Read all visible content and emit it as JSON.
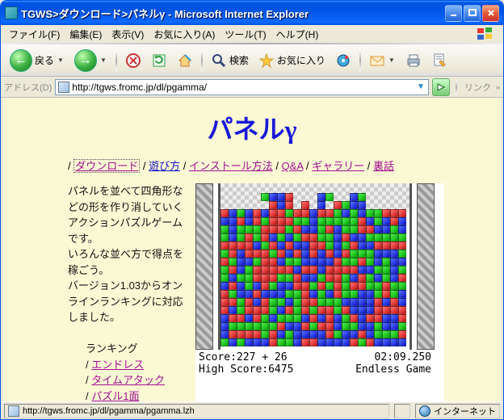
{
  "window": {
    "title": "TGWS>ダウンロード>パネルγ - Microsoft Internet Explorer"
  },
  "menubar": {
    "items": [
      "ファイル(F)",
      "編集(E)",
      "表示(V)",
      "お気に入り(A)",
      "ツール(T)",
      "ヘルプ(H)"
    ]
  },
  "toolbar": {
    "back": "戻る",
    "search": "検索",
    "favorites": "お気に入り"
  },
  "addressbar": {
    "label": "アドレス(D)",
    "url": "http://tgws.fromc.jp/dl/pgamma/",
    "links": "リンク"
  },
  "page": {
    "heading": "パネルγ",
    "nav": {
      "sep": " / ",
      "items": [
        "ダウンロード",
        "遊び方",
        "インストール方法",
        "Q&A",
        "ギャラリー",
        "裏話"
      ]
    },
    "desc": {
      "p1": "パネルを並べて四角形などの形を作り消していくアクションパズルゲームです。",
      "p2": "いろんな並べ方で得点を稼ごう。",
      "p3": "バージョン1.03からオンラインランキングに対応しました。",
      "rank_hd": "ランキング",
      "rank_items": [
        "エンドレス",
        "タイムアタック",
        "パズル1面"
      ]
    }
  },
  "game": {
    "score_label": "Score:",
    "score": "227 + 26",
    "time": "02:09.250",
    "hiscore_label": "High Score:",
    "hiscore": "6475",
    "mode": "Endless Game"
  },
  "statusbar": {
    "url": "http://tgws.fromc.jp/dl/pgamma/pgamma.lzh",
    "zone": "インターネット"
  }
}
